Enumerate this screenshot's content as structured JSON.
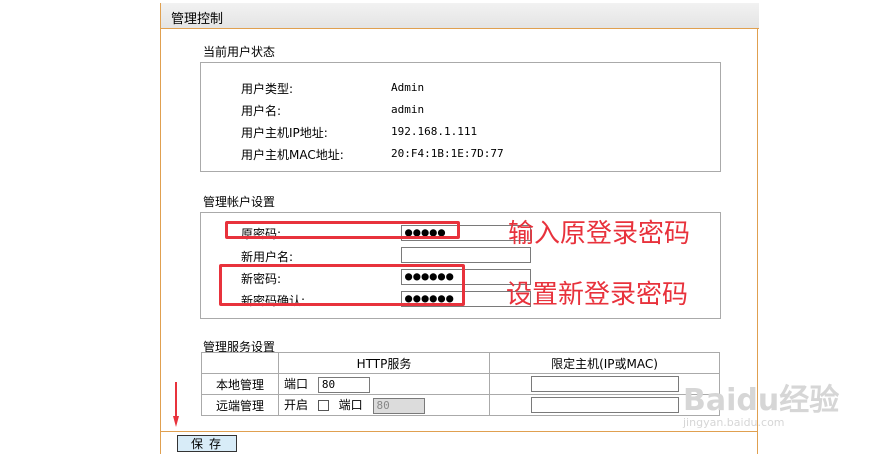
{
  "panel": {
    "title": "管理控制"
  },
  "status": {
    "heading": "当前用户状态",
    "rows": [
      {
        "label": "用户类型:",
        "value": "Admin"
      },
      {
        "label": "用户名:",
        "value": "admin"
      },
      {
        "label": "用户主机IP地址:",
        "value": "192.168.1.111"
      },
      {
        "label": "用户主机MAC地址:",
        "value": "20:F4:1B:1E:7D:77"
      }
    ]
  },
  "account": {
    "heading": "管理帐户设置",
    "old_password_label": "原密码:",
    "old_password_value": "●●●●●",
    "new_username_label": "新用户名:",
    "new_username_value": "",
    "new_password_label": "新密码:",
    "new_password_value": "●●●●●●",
    "confirm_password_label": "新密码确认:",
    "confirm_password_value": "●●●●●●"
  },
  "annotations": {
    "old_password_note": "输入原登录密码",
    "new_password_note": "设置新登录密码",
    "highlight_color": "#e8323c"
  },
  "service": {
    "heading": "管理服务设置",
    "col_http": "HTTP服务",
    "col_host": "限定主机(IP或MAC)",
    "local_label": "本地管理",
    "remote_label": "远端管理",
    "port_label": "端口",
    "enable_label": "开启",
    "local_port": "80",
    "remote_port": "80",
    "local_host": "",
    "remote_host": ""
  },
  "save": {
    "label": "保存"
  },
  "watermark": {
    "brand": "Baidu经验",
    "url": "jingyan.baidu.com"
  },
  "colors": {
    "panel_border": "#e0a050",
    "save_button_bg": "#d8ecf8"
  }
}
